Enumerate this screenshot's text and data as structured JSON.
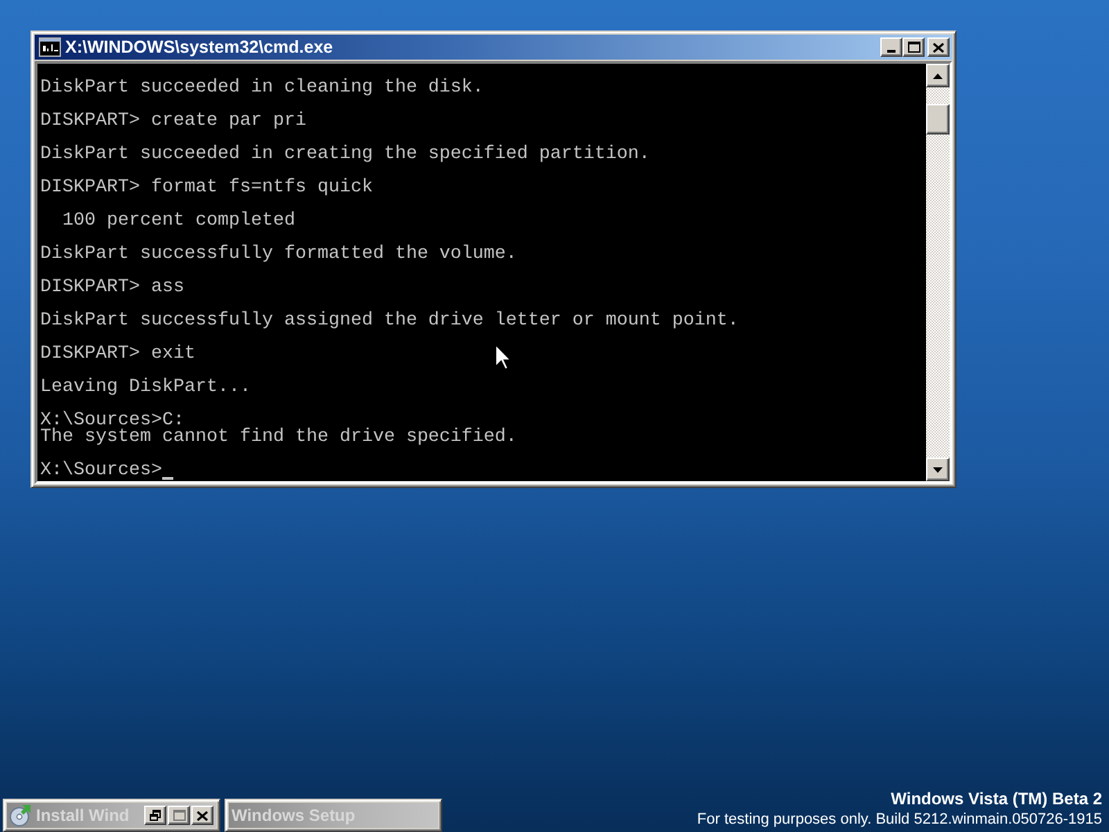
{
  "window": {
    "title": "X:\\WINDOWS\\system32\\cmd.exe"
  },
  "console": {
    "blocks": [
      {
        "lines": [
          "DiskPart succeeded in cleaning the disk."
        ]
      },
      {
        "lines": [
          "DISKPART> create par pri"
        ]
      },
      {
        "lines": [
          "DiskPart succeeded in creating the specified partition."
        ]
      },
      {
        "lines": [
          "DISKPART> format fs=ntfs quick"
        ]
      },
      {
        "lines": [
          "  100 percent completed"
        ]
      },
      {
        "lines": [
          "DiskPart successfully formatted the volume."
        ]
      },
      {
        "lines": [
          "DISKPART> ass"
        ]
      },
      {
        "lines": [
          "DiskPart successfully assigned the drive letter or mount point."
        ]
      },
      {
        "lines": [
          "DISKPART> exit"
        ]
      },
      {
        "lines": [
          "Leaving DiskPart..."
        ]
      },
      {
        "lines": [
          "X:\\Sources>C:",
          "The system cannot find the drive specified."
        ]
      },
      {
        "lines": [
          "X:\\Sources>"
        ]
      }
    ],
    "cursor": true
  },
  "minimized_windows": [
    {
      "title": "Install Wind",
      "kind": "controls"
    },
    {
      "title": "Windows Setup",
      "kind": "plain"
    }
  ],
  "build_info": {
    "edition": "Windows Vista (TM) Beta 2",
    "note": "For testing purposes only. Build 5212.winmain.050726-1915"
  }
}
